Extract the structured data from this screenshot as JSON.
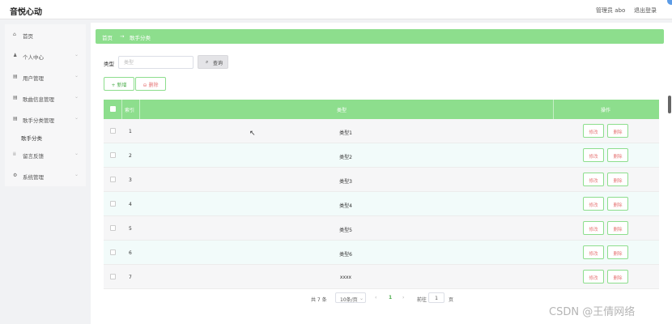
{
  "app": {
    "brand": "音悦心动"
  },
  "header": {
    "admin": "管理员 abo",
    "logout": "退出登录"
  },
  "sidebar": {
    "items": [
      {
        "icon": "⌂",
        "label": "首页"
      },
      {
        "icon": "♟",
        "label": "个人中心",
        "chevron": "⌄"
      },
      {
        "icon": "▤",
        "label": "用户管理",
        "chevron": "⌄"
      },
      {
        "icon": "▤",
        "label": "歌曲信息管理",
        "chevron": "⌄"
      },
      {
        "icon": "▤",
        "label": "歌手分类管理",
        "chevron": "⌄"
      },
      {
        "icon": "⁞⁞",
        "label": "留言反馈",
        "chevron": "⌄"
      },
      {
        "icon": "⚙",
        "label": "系统管理",
        "chevron": "⌄"
      }
    ],
    "submenu": {
      "label": "歌手分类"
    }
  },
  "breadcrumb": {
    "home": "首页",
    "sep": "→",
    "current": "歌手分类"
  },
  "search": {
    "label": "类型",
    "placeholder": "类型",
    "value": "",
    "query_icon": "⌕",
    "query_label": "查询"
  },
  "actions": {
    "add": "+ 新增",
    "delete": "⊖ 删除"
  },
  "table": {
    "headers": {
      "index": "索引",
      "type": "类型",
      "ops": "操作"
    },
    "rows": [
      {
        "index": "1",
        "type": "类型1",
        "edit": "修改",
        "delete": "删除"
      },
      {
        "index": "2",
        "type": "类型2",
        "edit": "修改",
        "delete": "删除"
      },
      {
        "index": "3",
        "type": "类型3",
        "edit": "修改",
        "delete": "删除"
      },
      {
        "index": "4",
        "type": "类型4",
        "edit": "修改",
        "delete": "删除"
      },
      {
        "index": "5",
        "type": "类型5",
        "edit": "修改",
        "delete": "删除"
      },
      {
        "index": "6",
        "type": "类型6",
        "edit": "修改",
        "delete": "删除"
      },
      {
        "index": "7",
        "type": "xxxx",
        "edit": "修改",
        "delete": "删除"
      }
    ]
  },
  "pagination": {
    "total": "共 7 条",
    "page_size": "10条/页",
    "page_size_chev": "⌄",
    "prev": "‹",
    "current": "1",
    "next": "›",
    "goto": "前往",
    "jump_value": "1",
    "page_suffix": "页"
  },
  "cursor": "↖",
  "watermark": "CSDN @王倩网络",
  "colors": {
    "accent": "#8dde8d",
    "row_odd": "#f6f6f7",
    "row_even": "#f2fbfa",
    "danger_text": "#e67676"
  }
}
